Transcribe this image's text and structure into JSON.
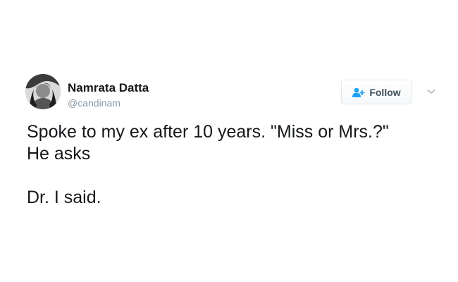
{
  "tweet": {
    "author": {
      "display_name": "Namrata Datta",
      "handle": "@candinam",
      "avatar_icon": "profile-photo"
    },
    "follow": {
      "label": "Follow",
      "icon": "add-user-icon",
      "icon_color": "#1da1f2"
    },
    "menu_icon": "chevron-down-icon",
    "text_lines": [
      "Spoke to my ex after 10 years. \"Miss or Mrs.?\"",
      "He asks",
      "Dr. I said."
    ]
  }
}
